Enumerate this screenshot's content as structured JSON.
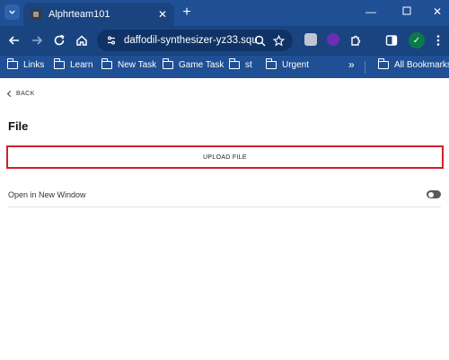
{
  "browser": {
    "tab": {
      "title": "Alphrteam101"
    },
    "address_bar": {
      "url": "daffodil-synthesizer-yz33.squ..."
    },
    "bookmarks": [
      {
        "label": "Links"
      },
      {
        "label": "Learn"
      },
      {
        "label": "New Task"
      },
      {
        "label": "Game Task"
      },
      {
        "label": "st"
      },
      {
        "label": "Urgent"
      }
    ],
    "all_bookmarks_label": "All Bookmarks",
    "overflow_label": "»"
  },
  "page": {
    "back_label": "BACK",
    "title": "File",
    "upload_label": "UPLOAD FILE",
    "open_new_window_label": "Open in New Window",
    "open_new_window_enabled": false
  },
  "colors": {
    "chrome_bg": "#1f4f94",
    "highlight_border": "#d0202a"
  }
}
